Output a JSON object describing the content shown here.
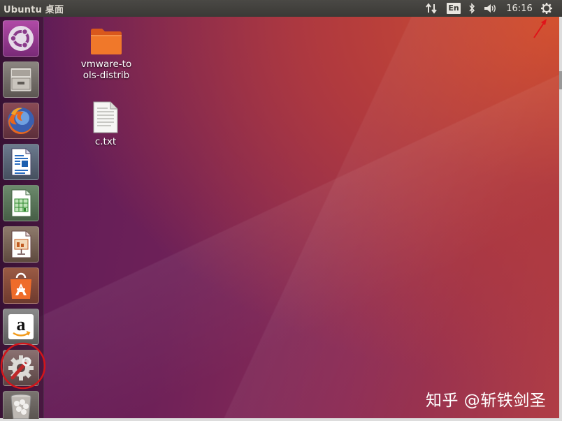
{
  "topbar": {
    "title": "Ubuntu 桌面",
    "keyboard_layout": "En",
    "clock": "16:16",
    "indicators": [
      "network-icon",
      "keyboard-layout-indicator",
      "bluetooth-icon",
      "volume-icon",
      "clock",
      "system-gear-icon"
    ]
  },
  "launcher": {
    "items": [
      {
        "name": "ubuntu-dash-button",
        "icon": "ubuntu-logo-icon"
      },
      {
        "name": "files-button",
        "icon": "file-cabinet-icon"
      },
      {
        "name": "firefox-button",
        "icon": "firefox-icon"
      },
      {
        "name": "libreoffice-writer-button",
        "icon": "writer-document-icon"
      },
      {
        "name": "libreoffice-calc-button",
        "icon": "calc-spreadsheet-icon"
      },
      {
        "name": "libreoffice-impress-button",
        "icon": "impress-presentation-icon"
      },
      {
        "name": "software-center-button",
        "icon": "shopping-bag-icon"
      },
      {
        "name": "amazon-button",
        "icon": "amazon-icon"
      },
      {
        "name": "system-settings-button",
        "icon": "settings-wrench-gear-icon"
      },
      {
        "name": "trash-button",
        "icon": "trash-icon"
      }
    ]
  },
  "desktop": {
    "icons": [
      {
        "label": "vmware-tools-distrib",
        "icon": "folder-icon"
      },
      {
        "label": "c.txt",
        "icon": "text-file-icon"
      }
    ]
  },
  "annotations": {
    "circle_color": "#d4141a",
    "arrow_color": "#e0141a"
  },
  "watermark": "知乎 @斩铁剑圣",
  "colors": {
    "topbar": "#3c3b37",
    "desktop_left": "#5d1b57",
    "desktop_right": "#d3502e"
  }
}
